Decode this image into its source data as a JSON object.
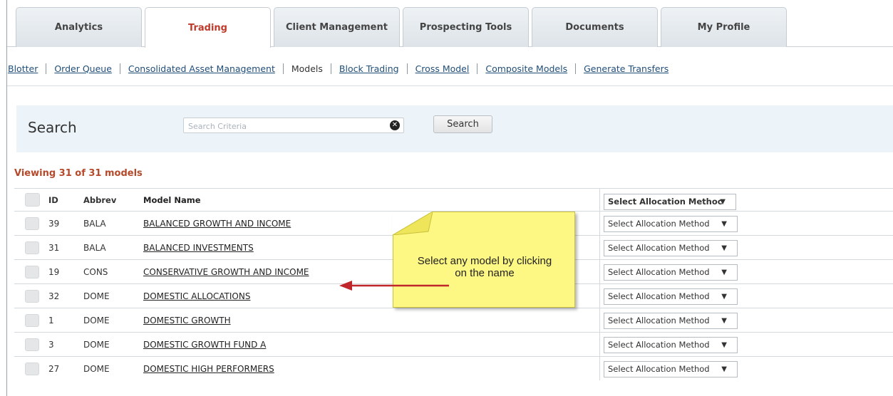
{
  "tabs": [
    {
      "label": "Analytics",
      "active": false
    },
    {
      "label": "Trading",
      "active": true
    },
    {
      "label": "Client Management",
      "active": false
    },
    {
      "label": "Prospecting Tools",
      "active": false
    },
    {
      "label": "Documents",
      "active": false
    },
    {
      "label": "My Profile",
      "active": false
    }
  ],
  "subnav": [
    "Blotter",
    "Order Queue",
    "Consolidated Asset Management",
    "Models",
    "Block Trading",
    "Cross Model",
    "Composite Models",
    "Generate Transfers"
  ],
  "subnav_current": "Models",
  "search": {
    "label": "Search",
    "placeholder": "Search Criteria",
    "value": "",
    "button_label": "Search"
  },
  "viewing_text": "Viewing 31 of 31 models",
  "table": {
    "columns": {
      "id": "ID",
      "abbrev": "Abbrev",
      "name": "Model Name",
      "allocation_header": "Select Allocation Methoc"
    },
    "rows": [
      {
        "id": "39",
        "abbrev": "BALA",
        "name": "BALANCED GROWTH AND INCOME",
        "allocation": "Select Allocation Method"
      },
      {
        "id": "31",
        "abbrev": "BALA",
        "name": "BALANCED INVESTMENTS",
        "allocation": "Select Allocation Method"
      },
      {
        "id": "19",
        "abbrev": "CONS",
        "name": "CONSERVATIVE GROWTH AND INCOME",
        "allocation": "Select Allocation Method"
      },
      {
        "id": "32",
        "abbrev": "DOME",
        "name": "DOMESTIC ALLOCATIONS",
        "allocation": "Select Allocation Method"
      },
      {
        "id": "1",
        "abbrev": "DOME",
        "name": "DOMESTIC GROWTH",
        "allocation": "Select Allocation Method"
      },
      {
        "id": "3",
        "abbrev": "DOME",
        "name": "DOMESTIC GROWTH FUND A",
        "allocation": "Select Allocation Method"
      },
      {
        "id": "27",
        "abbrev": "DOME",
        "name": "DOMESTIC HIGH PERFORMERS",
        "allocation": "Select Allocation Method"
      }
    ]
  },
  "callout": {
    "line1": "Select any model by clicking",
    "line2": "on the name",
    "color": "#fdf783",
    "arrow_color": "#c0272d"
  },
  "icons": {
    "clear": "clear-circle-x-icon",
    "dropdown": "dropdown-triangle-icon",
    "arrow": "callout-arrow-icon"
  }
}
